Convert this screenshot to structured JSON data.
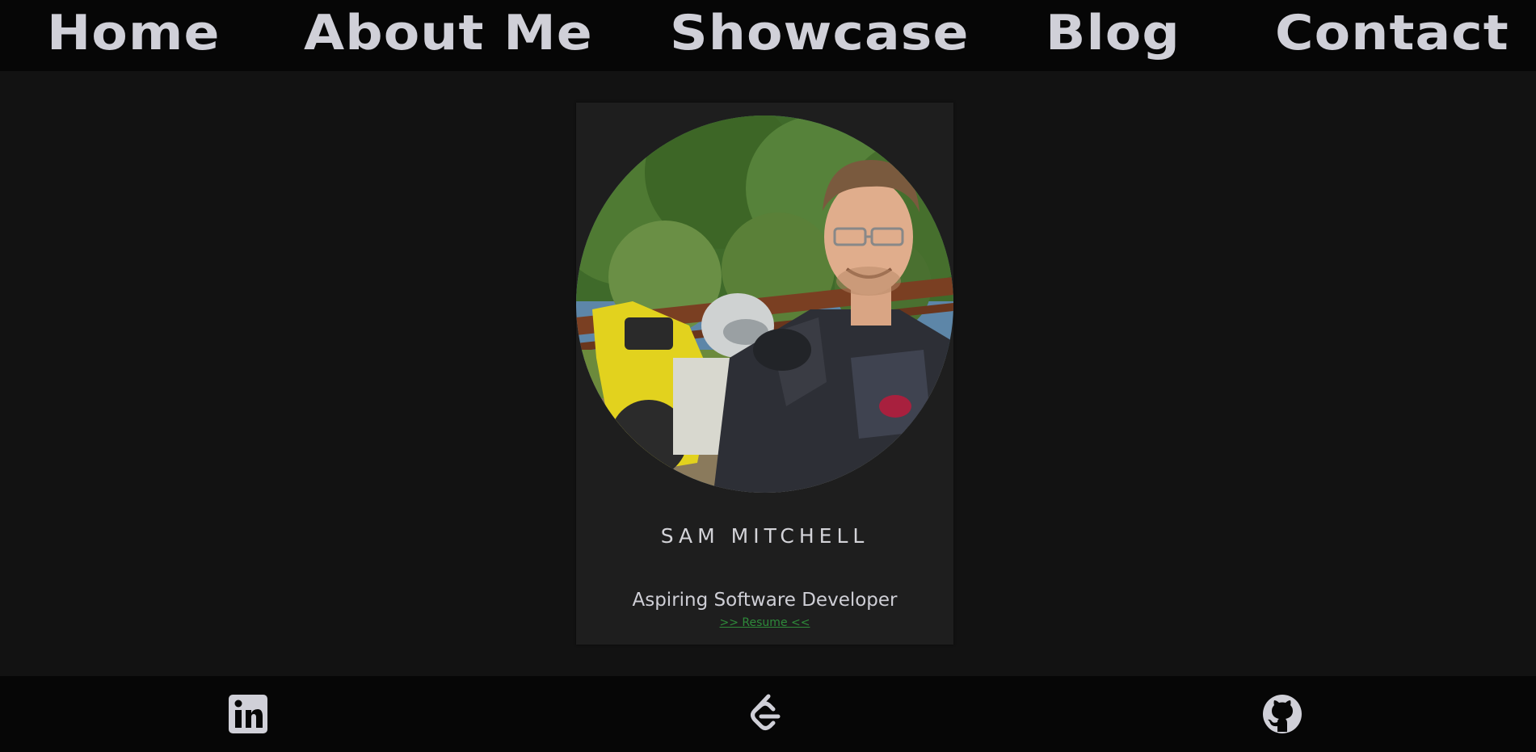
{
  "nav": {
    "items": [
      {
        "label": "Home"
      },
      {
        "label": "About Me"
      },
      {
        "label": "Showcase"
      },
      {
        "label": "Blog"
      },
      {
        "label": "Contact"
      }
    ]
  },
  "profile": {
    "name": "SAM MITCHELL",
    "role": "Aspiring Software Developer",
    "resume_link": ">> Resume <<",
    "photo_icon": "profile-photo"
  },
  "footer": {
    "links": [
      {
        "icon": "linkedin-icon"
      },
      {
        "icon": "leetcode-icon"
      },
      {
        "icon": "github-icon"
      }
    ]
  },
  "colors": {
    "page_bg": "#121212",
    "bar_bg": "#060606",
    "card_bg": "#1e1e1e",
    "text": "#d0d0d8",
    "resume_link": "#2e8a3a"
  }
}
